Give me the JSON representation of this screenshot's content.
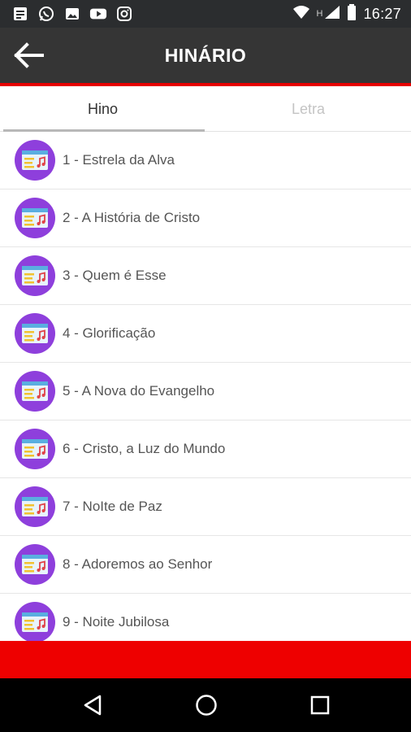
{
  "statusbar": {
    "left_icons": [
      "notes-icon",
      "whatsapp-icon",
      "image-icon",
      "youtube-icon",
      "instagram-icon"
    ],
    "network_label": "H",
    "time": "16:27"
  },
  "appbar": {
    "title": "HINÁRIO",
    "back_icon": "arrow-left-icon"
  },
  "tabs": [
    {
      "label": "Hino",
      "active": true
    },
    {
      "label": "Letra",
      "active": false
    }
  ],
  "hymns": [
    "1 - Estrela da Alva",
    "2 - A História de Cristo",
    "3 - Quem é Esse",
    "4 - Glorificação",
    "5 - A Nova do Evangelho",
    "6 - Cristo, a Luz do Mundo",
    "7 - NoIte de Paz",
    "8 - Adoremos ao Senhor",
    "9 - Noite Jubilosa"
  ],
  "colors": {
    "appbar": "#353535",
    "accent_red": "#e60000",
    "avatar_purple": "#8e3fdc"
  }
}
